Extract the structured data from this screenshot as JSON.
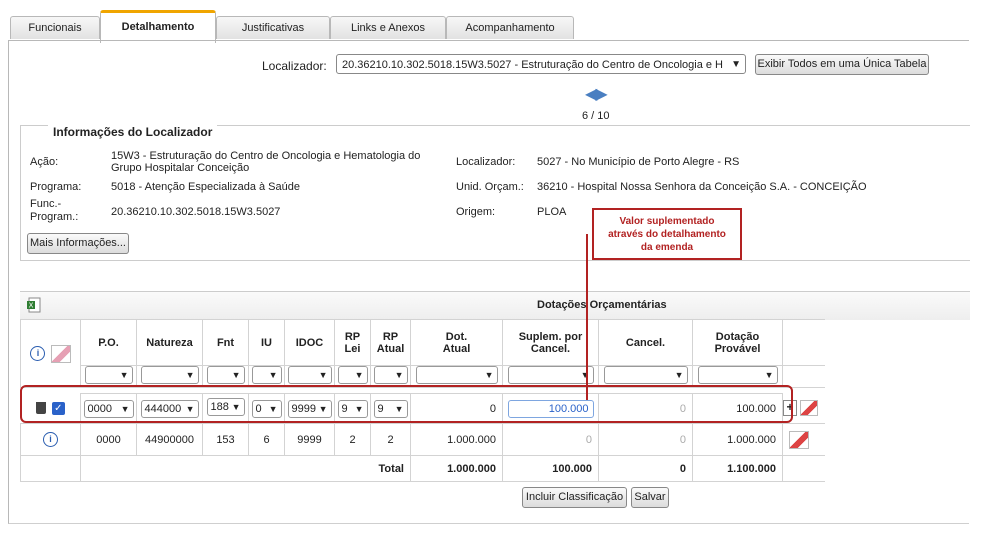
{
  "tabs": [
    {
      "label": "Funcionais"
    },
    {
      "label": "Detalhamento",
      "active": true
    },
    {
      "label": "Justificativas"
    },
    {
      "label": "Links e Anexos"
    },
    {
      "label": "Acompanhamento"
    }
  ],
  "localizador": {
    "label": "Localizador:",
    "value": "20.36210.10.302.5018.15W3.5027 - Estruturação do Centro de Oncologia e H",
    "show_all_button": "Exibir Todos em uma Única Tabela",
    "pager": "6 / 10"
  },
  "info": {
    "legend": "Informações do Localizador",
    "acao_label": "Ação:",
    "acao_value_1": "15W3 - Estruturação do Centro de Oncologia e Hematologia do",
    "acao_value_2": "Grupo Hospitalar Conceição",
    "programa_label": "Programa:",
    "programa_value": "5018 - Atenção Especializada à Saúde",
    "func_label_1": "Func.-",
    "func_label_2": "Program.:",
    "func_value": "20.36210.10.302.5018.15W3.5027",
    "localizador_label": "Localizador:",
    "localizador_value": "5027 - No Município de Porto Alegre - RS",
    "unid_label": "Unid. Orçam.:",
    "unid_value": "36210 - Hospital Nossa Senhora da Conceição S.A. - CONCEIÇÃO",
    "origem_label": "Origem:",
    "origem_value": "PLOA",
    "more_button": "Mais Informações..."
  },
  "grid": {
    "title": "Dotações Orçamentárias",
    "headers": {
      "po": "P.O.",
      "natureza": "Natureza",
      "fnt": "Fnt",
      "iu": "IU",
      "idoc": "IDOC",
      "rp_lei_1": "RP",
      "rp_lei_2": "Lei",
      "rp_atual_1": "RP",
      "rp_atual_2": "Atual",
      "dot_atual_1": "Dot.",
      "dot_atual_2": "Atual",
      "suplem_1": "Suplem. por",
      "suplem_2": "Cancel.",
      "cancel": "Cancel.",
      "dot_prov_1": "Dotação",
      "dot_prov_2": "Provável"
    },
    "edit_row": {
      "po": "0000",
      "natureza": "444000",
      "fnt": "188",
      "iu": "0",
      "idoc": "9999",
      "rp_lei": "9",
      "rp_atual": "9",
      "dot_atual": "0",
      "suplem": "100.000",
      "cancel": "0",
      "dot_prov": "100.000",
      "add_symbol": "+"
    },
    "data_row": {
      "po": "0000",
      "natureza": "44900000",
      "fnt": "153",
      "iu": "6",
      "idoc": "9999",
      "rp_lei": "2",
      "rp_atual": "2",
      "dot_atual": "1.000.000",
      "suplem": "0",
      "cancel": "0",
      "dot_prov": "1.000.000"
    },
    "total_row": {
      "label": "Total",
      "dot_atual": "1.000.000",
      "suplem": "100.000",
      "cancel": "0",
      "dot_prov": "1.100.000"
    }
  },
  "buttons": {
    "incluir": "Incluir Classificação",
    "salvar": "Salvar"
  },
  "annotation": {
    "line1": "Valor suplementado",
    "line2": "através do detalhamento",
    "line3": "da emenda",
    "color": "#b22222"
  }
}
